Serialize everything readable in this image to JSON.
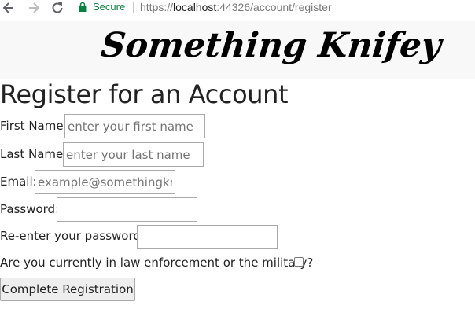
{
  "browser": {
    "secure_label": "Secure",
    "url_scheme": "https://",
    "url_host": "localhost",
    "url_rest": ":44326/account/register",
    "icons": {
      "back": "back-arrow-icon",
      "forward": "forward-arrow-icon",
      "reload": "reload-icon",
      "lock": "lock-icon"
    }
  },
  "header": {
    "brand": "Something Knifey"
  },
  "page": {
    "title": "Register for an Account"
  },
  "form": {
    "first_name": {
      "label": "First Name:",
      "placeholder": "enter your first name",
      "value": ""
    },
    "last_name": {
      "label": "Last Name:",
      "placeholder": "enter your last name",
      "value": ""
    },
    "email": {
      "label": "Email:",
      "placeholder": "example@somethingknifey.com",
      "value": ""
    },
    "password": {
      "label": "Password:",
      "value": ""
    },
    "password_confirm": {
      "label": "Re-enter your password:",
      "value": ""
    },
    "law_enforcement": {
      "label": "Are you currently in law enforcement or the military?",
      "checked": false
    },
    "submit_label": "Complete Registration"
  },
  "colors": {
    "secure_green": "#0b8043",
    "banner_bg": "#f8f8f8",
    "button_bg": "#eeeeee"
  }
}
